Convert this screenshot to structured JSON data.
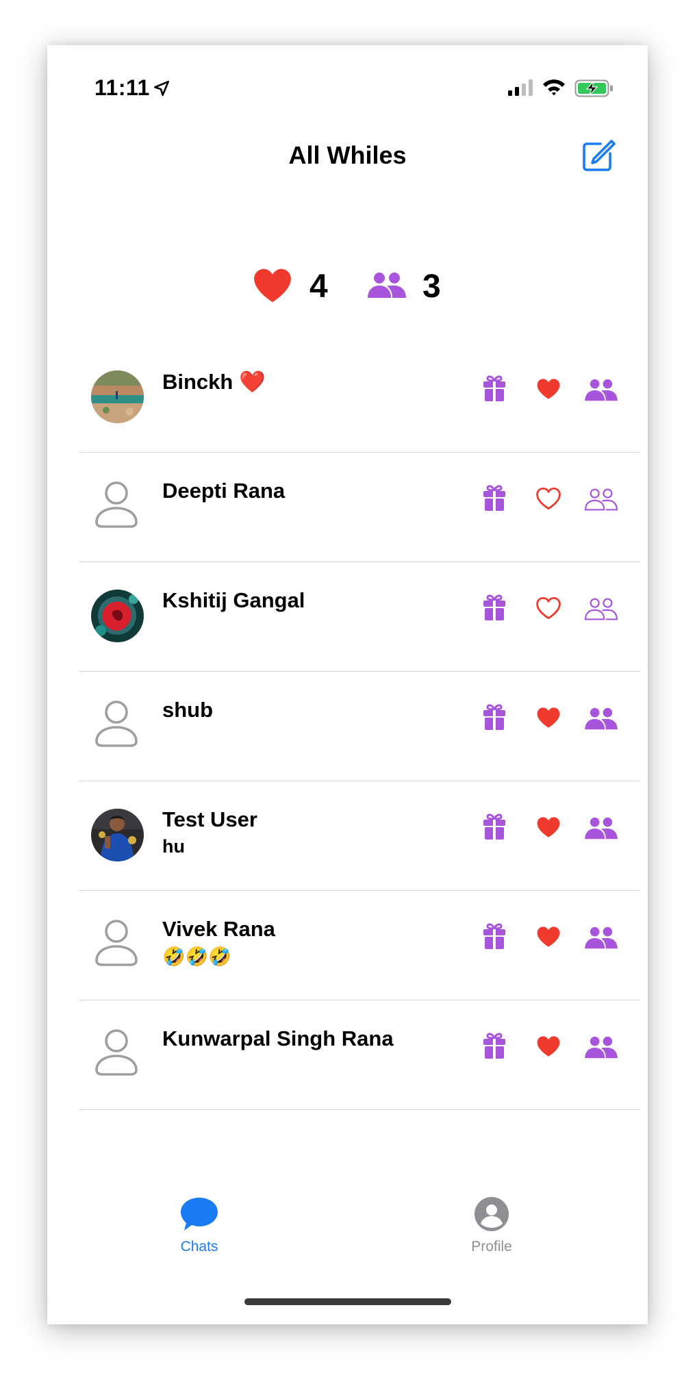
{
  "status_bar": {
    "time": "11:11",
    "location_icon": "location-arrow-icon",
    "signal_icon": "cellular-signal-icon",
    "wifi_icon": "wifi-icon",
    "battery_icon": "battery-charging-icon"
  },
  "header": {
    "title": "All Whiles",
    "compose_icon": "compose-icon"
  },
  "summary": {
    "hearts_count": "4",
    "friends_count": "3"
  },
  "contacts": [
    {
      "name": "Binckh ❤️",
      "subtitle": "",
      "avatar": "photo-landscape",
      "heart_filled": true,
      "friends_filled": true
    },
    {
      "name": "Deepti Rana",
      "subtitle": "",
      "avatar": "placeholder",
      "heart_filled": false,
      "friends_filled": false
    },
    {
      "name": "Kshitij Gangal",
      "subtitle": "",
      "avatar": "photo-red",
      "heart_filled": false,
      "friends_filled": false
    },
    {
      "name": "shub",
      "subtitle": "",
      "avatar": "placeholder",
      "heart_filled": true,
      "friends_filled": true
    },
    {
      "name": "Test User",
      "subtitle": "hu",
      "avatar": "photo-person",
      "heart_filled": true,
      "friends_filled": true
    },
    {
      "name": "Vivek Rana",
      "subtitle": "🤣🤣🤣",
      "avatar": "placeholder",
      "heart_filled": true,
      "friends_filled": true
    },
    {
      "name": "Kunwarpal Singh Rana",
      "subtitle": "",
      "avatar": "placeholder",
      "heart_filled": true,
      "friends_filled": true
    }
  ],
  "tabbar": {
    "chats_label": "Chats",
    "profile_label": "Profile"
  },
  "colors": {
    "accent_blue": "#1a7cf2",
    "heart_red": "#f03a2e",
    "purple": "#a855dd",
    "inactive_gray": "#8e8e93"
  }
}
